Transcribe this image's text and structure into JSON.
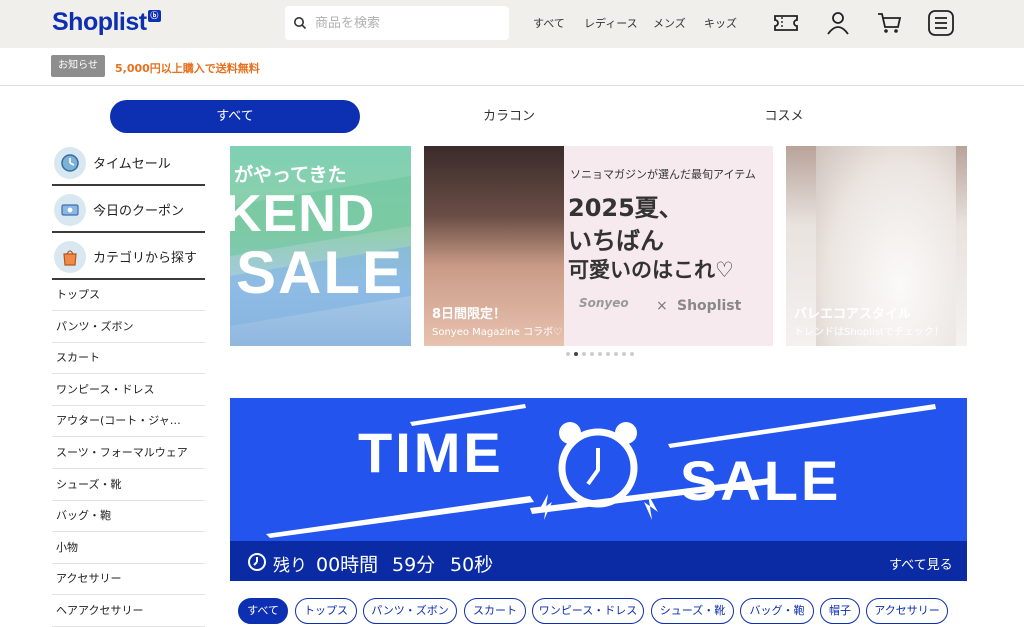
{
  "header": {
    "logo": "Shoplist",
    "logo_badge": "ⓑ",
    "search_placeholder": "商品を検索",
    "nav": [
      "すべて",
      "レディース",
      "メンズ",
      "キッズ"
    ],
    "icons": [
      "ticket-icon",
      "user-icon",
      "cart-icon",
      "menu-icon"
    ]
  },
  "notice": {
    "badge": "お知らせ",
    "text": "5,000円以上購入で送料無料"
  },
  "tabs": [
    "すべて",
    "カラコン",
    "コスメ"
  ],
  "sidebar": {
    "features": [
      "タイムセール",
      "今日のクーポン",
      "カテゴリから探す"
    ],
    "categories": [
      "トップス",
      "パンツ・ズボン",
      "スカート",
      "ワンピース・ドレス",
      "アウター(コート・ジャ…",
      "スーツ・フォーマルウェア",
      "シューズ・靴",
      "バッグ・鞄",
      "小物",
      "アクセサリー",
      "ヘアアクセサリー"
    ]
  },
  "banners": {
    "b1": {
      "line1": "がやってきた",
      "line2": "KEND",
      "line3": "SALE"
    },
    "b2": {
      "top": "ソニョマガジンが選んだ最旬アイテム",
      "h1": "2025夏、",
      "h2": "いちばん",
      "h3": "可愛いのはこれ♡",
      "caption_title": "8日間限定！",
      "caption_sub": "Sonyeo Magazine コラボ♡",
      "logo_a": "Sonyeo",
      "logo_x": "×",
      "logo_b": "Shoplist"
    },
    "b3": {
      "caption_title": "バレエコアスタイル",
      "caption_sub": "トレンドはShoplistでチェック！"
    }
  },
  "carousel": {
    "count": 9,
    "active": 1
  },
  "timesale": {
    "word1": "TIME",
    "word2": "SALE",
    "remaining_label": "残り",
    "hours": "00時間",
    "minutes": "59分",
    "seconds": "50秒",
    "see_all": "すべて見る"
  },
  "chips": [
    "すべて",
    "トップス",
    "パンツ・ズボン",
    "スカート",
    "ワンピース・ドレス",
    "シューズ・靴",
    "バッグ・鞄",
    "帽子",
    "アクセサリー"
  ]
}
